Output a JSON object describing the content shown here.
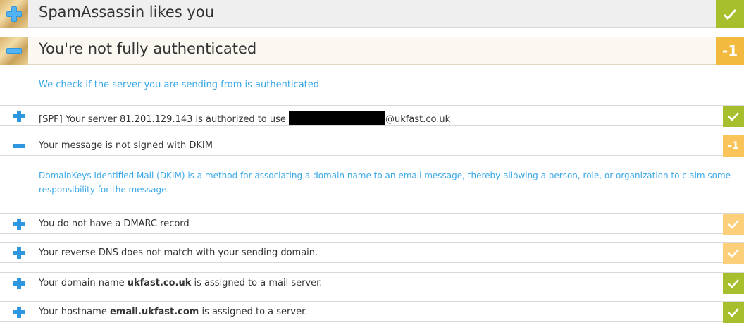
{
  "sections": {
    "collapsed": {
      "title": "SpamAssassin likes you",
      "badge": "✓"
    },
    "expanded": {
      "title": "You're not fully authenticated",
      "badge": "-1",
      "description": "We check if the server you are sending from is authenticated"
    }
  },
  "rows": {
    "spf": {
      "prefix": "[SPF] Your server 81.201.129.143 is authorized to use ",
      "suffix": "@ukfast.co.uk",
      "badge": "✓"
    },
    "dkim": {
      "text": "Your message is not signed with DKIM",
      "badge": "-1",
      "detail": "DomainKeys Identified Mail (DKIM) is a method for associating a domain name to an email message, thereby allowing a person, role, or organization to claim some responsibility for the message."
    },
    "dmarc": {
      "text": "You do not have a DMARC record",
      "badge": "✓"
    },
    "rdns": {
      "text": "Your reverse DNS does not match with your sending domain.",
      "badge": "✓"
    },
    "domain": {
      "prefix": "Your domain name ",
      "bold": "ukfast.co.uk",
      "suffix": " is assigned to a mail server.",
      "badge": "✓"
    },
    "hostname": {
      "prefix": "Your hostname ",
      "bold": "email.ukfast.com",
      "suffix": " is assigned to a server.",
      "badge": "✓"
    }
  },
  "icons": {
    "expand": "plus-icon",
    "collapse": "minus-icon",
    "pass": "check-icon"
  },
  "colors": {
    "pass": "#a7bf2c",
    "warn": "#f2ba3e",
    "accent": "#3aa8e8"
  }
}
